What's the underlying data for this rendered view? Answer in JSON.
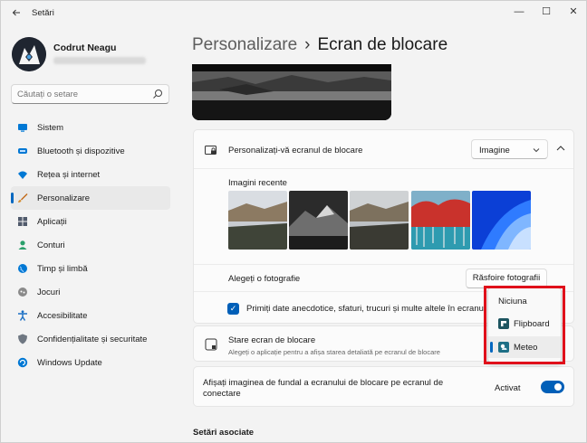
{
  "window": {
    "title": "Setări",
    "controls": {
      "minimize": "—",
      "maximize": "☐",
      "close": "✕"
    }
  },
  "user": {
    "name": "Codrut Neagu"
  },
  "search": {
    "placeholder": "Căutați o setare"
  },
  "sidebar": {
    "items": [
      {
        "label": "Sistem",
        "icon": "system-icon",
        "color": "#0078d4"
      },
      {
        "label": "Bluetooth și dispozitive",
        "icon": "bluetooth-icon",
        "color": "#0078d4"
      },
      {
        "label": "Rețea și internet",
        "icon": "network-icon",
        "color": "#0078d4"
      },
      {
        "label": "Personalizare",
        "icon": "brush-icon",
        "color": "#c26b19",
        "selected": true
      },
      {
        "label": "Aplicații",
        "icon": "apps-icon",
        "color": "#505a6b"
      },
      {
        "label": "Conturi",
        "icon": "accounts-icon",
        "color": "#2aa06b"
      },
      {
        "label": "Timp și limbă",
        "icon": "globe-icon",
        "color": "#0078d4"
      },
      {
        "label": "Jocuri",
        "icon": "gamepad-icon",
        "color": "#707070"
      },
      {
        "label": "Accesibilitate",
        "icon": "accessibility-icon",
        "color": "#1a6fc4"
      },
      {
        "label": "Confidențialitate și securitate",
        "icon": "shield-icon",
        "color": "#6f7782"
      },
      {
        "label": "Windows Update",
        "icon": "windows-update-icon",
        "color": "#0078d4"
      }
    ]
  },
  "header": {
    "parent": "Personalizare",
    "separator": "›",
    "current": "Ecran de blocare"
  },
  "lockscreen": {
    "title": "Personalizați-vă ecranul de blocare",
    "dropdown_value": "Imagine",
    "recent_label": "Imagini recente",
    "choose_label": "Alegeți o fotografie",
    "browse_button": "Răsfoire fotografii",
    "checkbox_label": "Primiți date anecdotice, sfaturi, trucuri și multe altele în ecranul de",
    "checkbox_checked": true
  },
  "status": {
    "title": "Stare ecran de blocare",
    "subtitle": "Alegeți o aplicație pentru a afișa starea detaliată pe ecranul de blocare"
  },
  "background": {
    "title": "Afișați imaginea de fundal a ecranului de blocare pe ecranul de conectare",
    "state": "Activat",
    "enabled": true
  },
  "related": {
    "title": "Setări asociate"
  },
  "popup": {
    "items": [
      {
        "label": "Niciuna",
        "icon": ""
      },
      {
        "label": "Flipboard",
        "icon": "flipboard-icon"
      },
      {
        "label": "Meteo",
        "icon": "weather-icon",
        "selected": true
      }
    ],
    "highlight_color": "#e0101a"
  },
  "colors": {
    "accent": "#005fb8",
    "window_bg": "#f3f3f3",
    "card_bg": "#fbfbfb"
  }
}
